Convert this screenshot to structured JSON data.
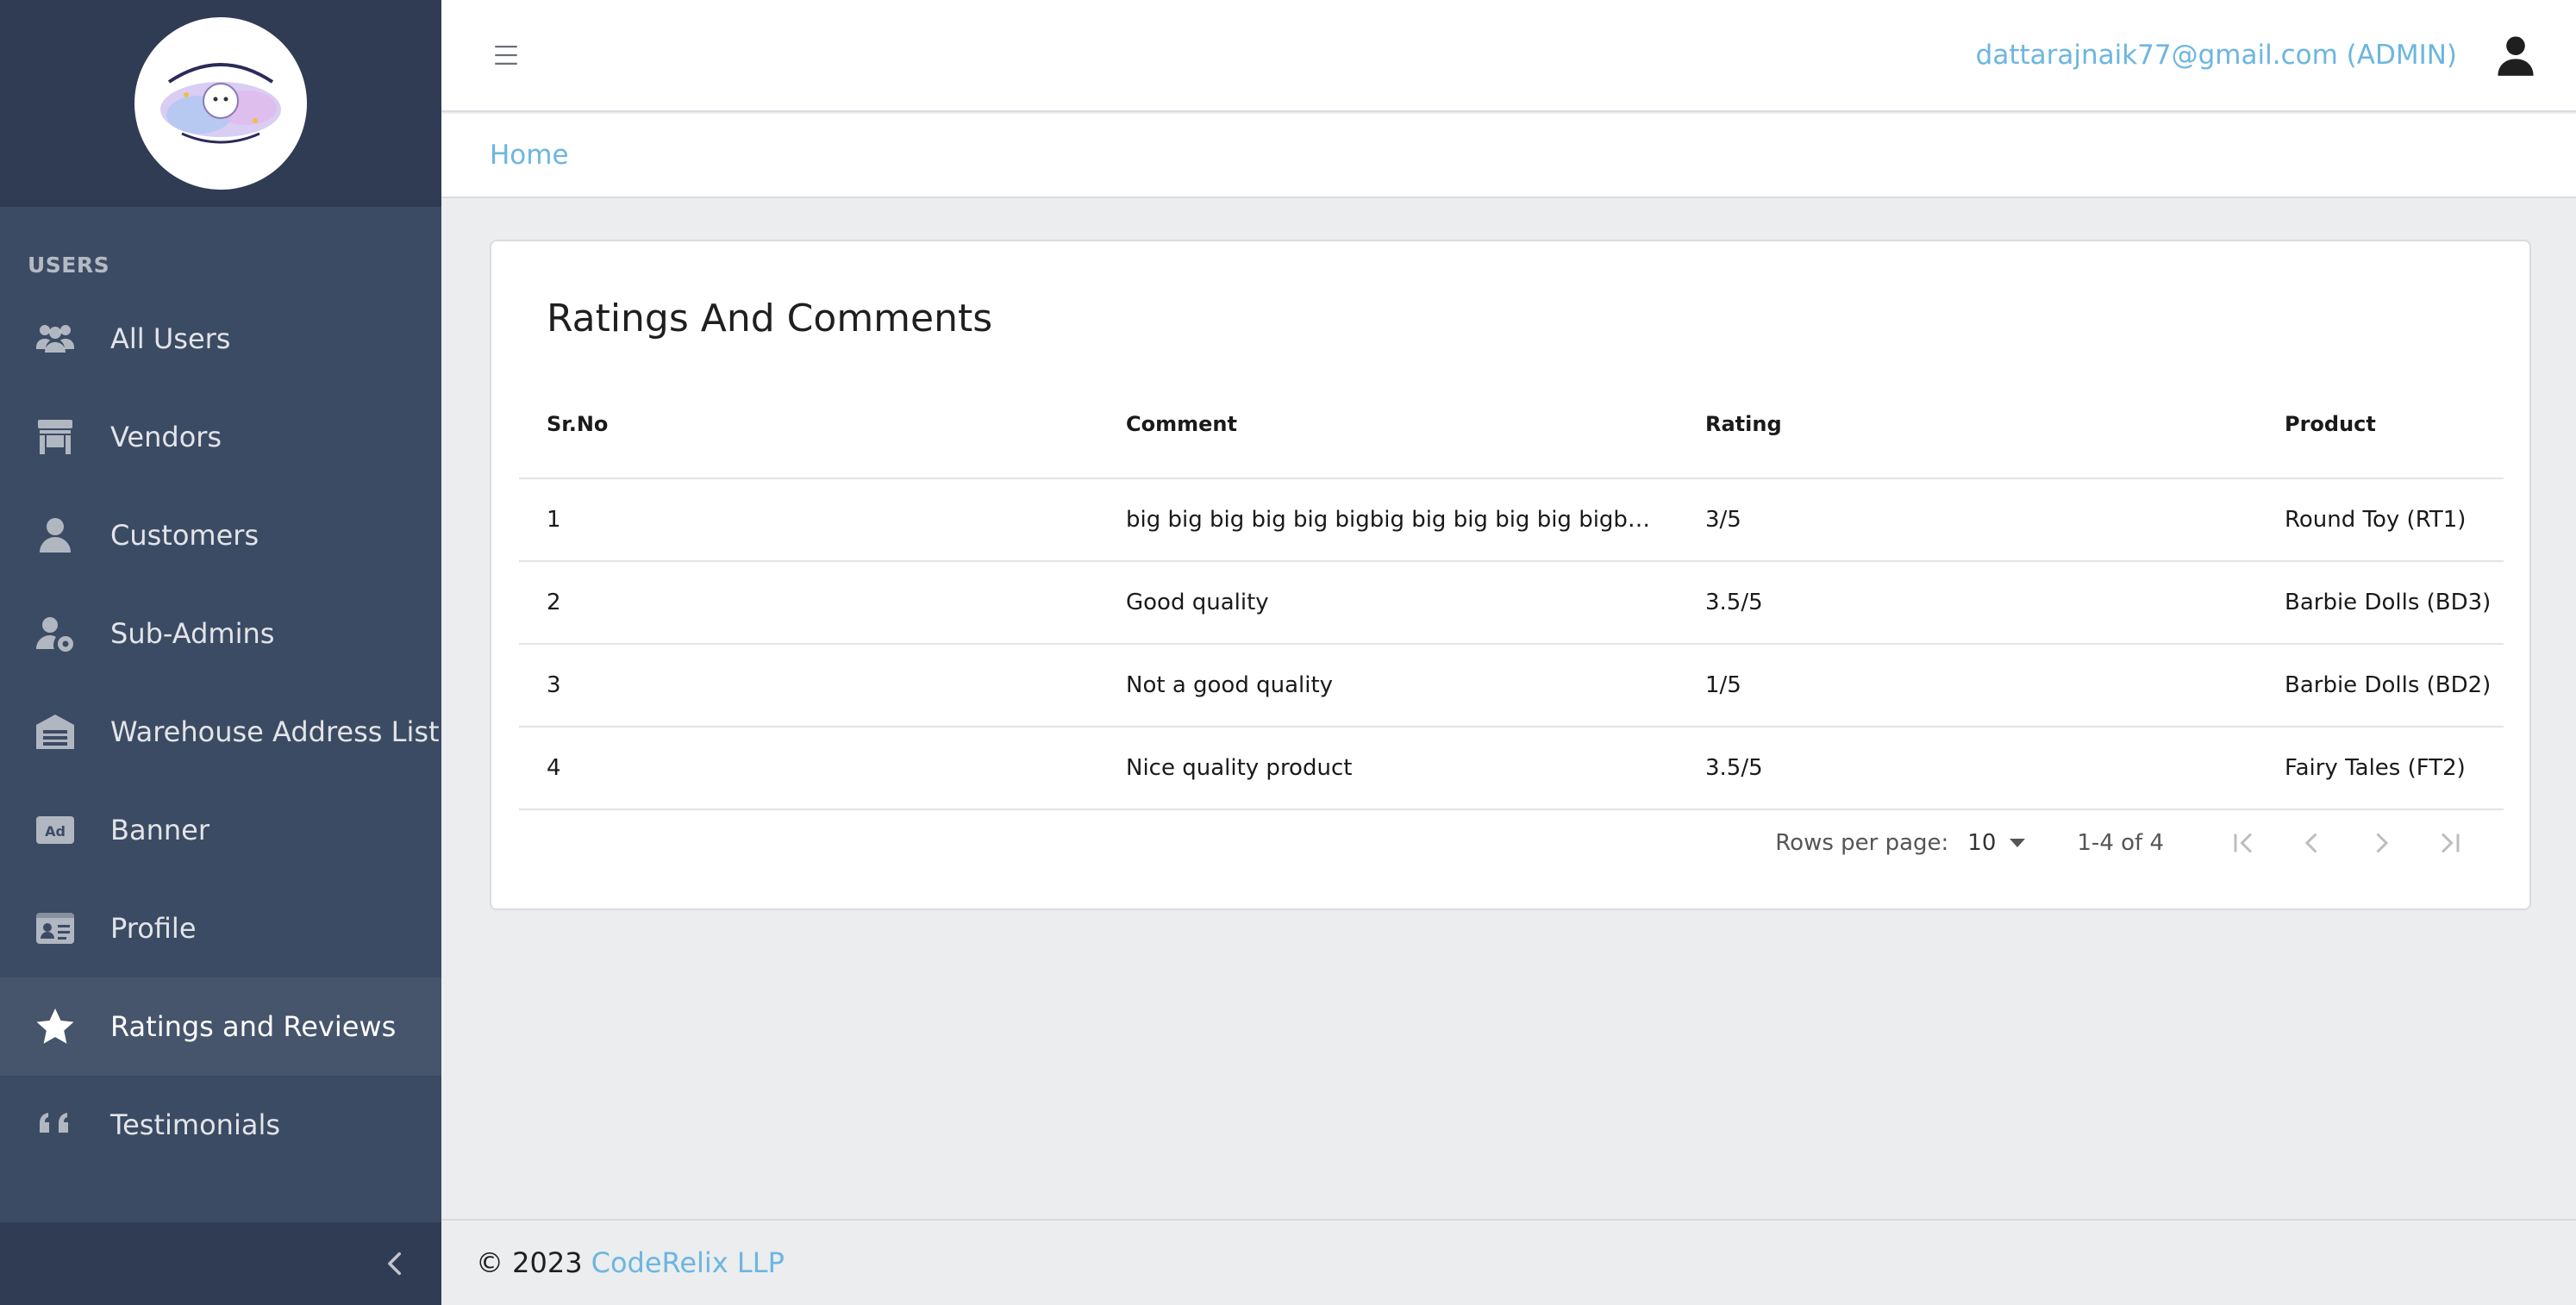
{
  "sidebar": {
    "logo_alt": "Toddlers & Tots",
    "section_title": "USERS",
    "items": [
      {
        "label": "All Users",
        "icon": "users-icon"
      },
      {
        "label": "Vendors",
        "icon": "store-icon"
      },
      {
        "label": "Customers",
        "icon": "user-icon"
      },
      {
        "label": "Sub-Admins",
        "icon": "user-gear-icon"
      },
      {
        "label": "Warehouse Address List",
        "icon": "warehouse-icon"
      },
      {
        "label": "Banner",
        "icon": "ad-icon"
      },
      {
        "label": "Profile",
        "icon": "id-card-icon"
      },
      {
        "label": "Ratings and Reviews",
        "icon": "star-icon",
        "active": true
      },
      {
        "label": "Testimonials",
        "icon": "quote-icon"
      }
    ]
  },
  "header": {
    "user": "dattarajnaik77@gmail.com (ADMIN)"
  },
  "breadcrumb": {
    "home": "Home"
  },
  "card": {
    "title": "Ratings And Comments"
  },
  "table": {
    "headers": [
      "Sr.No",
      "Comment",
      "Rating",
      "Product"
    ],
    "rows": [
      [
        "1",
        "big big big big big bigbig big big big big bigbig big…",
        "3/5",
        "Round Toy (RT1)"
      ],
      [
        "2",
        "Good quality",
        "3.5/5",
        "Barbie Dolls (BD3)"
      ],
      [
        "3",
        "Not a good quality",
        "1/5",
        "Barbie Dolls (BD2)"
      ],
      [
        "4",
        "Nice quality product",
        "3.5/5",
        "Fairy Tales (FT2)"
      ]
    ]
  },
  "pagination": {
    "rows_per_page_label": "Rows per page:",
    "rows_per_page": "10",
    "range": "1-4 of 4"
  },
  "footer": {
    "copyright": "© 2023",
    "company": "CodeRelix LLP"
  },
  "colors": {
    "sidebar": "#3c4b64",
    "sidebar_dark": "#303c54",
    "link": "#6cb6e0",
    "background": "#ebedef"
  }
}
